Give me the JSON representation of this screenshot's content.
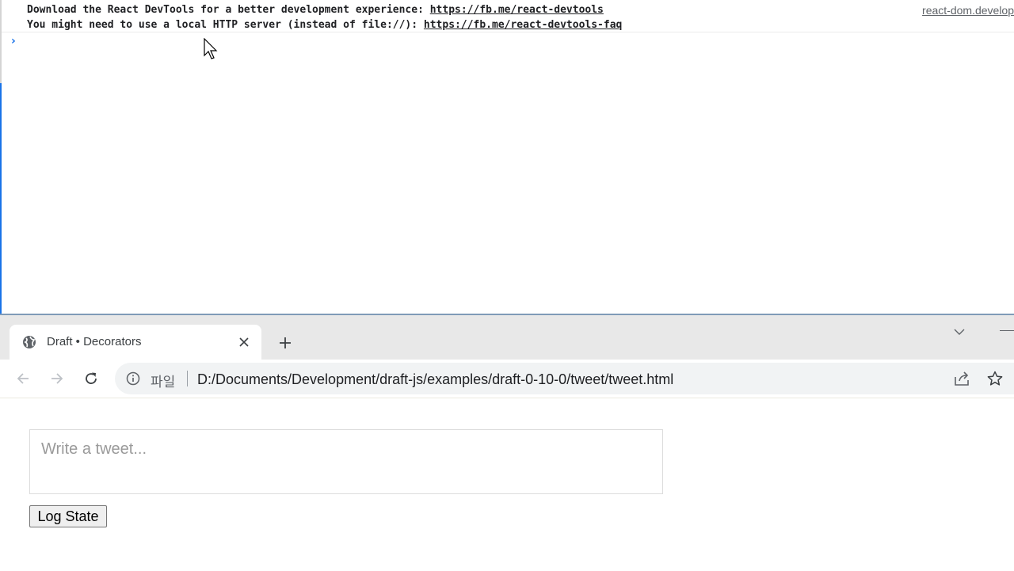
{
  "console": {
    "messages": [
      {
        "line1_text": "Download the React DevTools for a better development experience: ",
        "line1_link": "https://fb.me/react-devtools",
        "line2_text": "You might need to use a local HTTP server (instead of file://): ",
        "line2_link": "https://fb.me/react-devtools-faq",
        "source": "react-dom.develop"
      }
    ],
    "prompt_symbol": "›"
  },
  "browser": {
    "tab": {
      "title": "Draft • Decorators",
      "favicon": "globe-icon",
      "close_icon": "close-icon"
    },
    "new_tab_icon": "plus-icon",
    "tab_search_icon": "chevron-down-icon",
    "nav": {
      "back_icon": "back-arrow-icon",
      "forward_icon": "forward-arrow-icon",
      "reload_icon": "reload-icon"
    },
    "address_bar": {
      "security_icon": "info-icon",
      "security_label": "파일",
      "url": "D:/Documents/Development/draft-js/examples/draft-0-10-0/tweet/tweet.html",
      "share_icon": "share-icon",
      "bookmark_icon": "star-icon"
    }
  },
  "page": {
    "editor_placeholder": "Write a tweet...",
    "log_button_label": "Log State"
  },
  "colors": {
    "console_prompt": "#1a73e8",
    "tabstrip_bg": "#e8e8e8",
    "omnibox_bg": "#f1f3f4",
    "resizer": "#7f9bb8"
  }
}
